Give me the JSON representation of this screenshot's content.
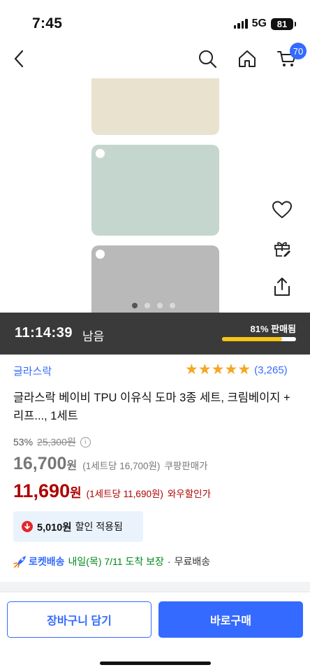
{
  "status": {
    "time": "7:45",
    "network": "5G",
    "battery": "81"
  },
  "nav": {
    "cart_count": "70",
    "icons": [
      "back-arrow-icon",
      "search-icon",
      "home-icon",
      "cart-icon"
    ]
  },
  "gallery": {
    "swatch_colors": [
      "#e8e2cf",
      "#c5d6ce",
      "#b9b9b9"
    ],
    "page_count": 4,
    "active_page": 1,
    "side_icons": [
      "heart-icon",
      "gift-icon",
      "share-icon"
    ]
  },
  "deal": {
    "time_left": "11:14:39",
    "time_suffix": "남음",
    "sold_text": "81% 판매됨",
    "sold_percent": 81
  },
  "product": {
    "brand": "글라스락",
    "rating_stars": 5,
    "review_count": "(3,265)",
    "title": "글라스락 베이비 TPU 이유식 도마 3종 세트, 크림베이지 + 리프..., 1세트"
  },
  "pricing": {
    "discount_rate": "53%",
    "original_price": "25,300원",
    "sale_price": "16,700",
    "won": "원",
    "sale_unit": "(1세트당 16,700원)",
    "sale_tag": "쿠팡판매가",
    "wow_price": "11,690",
    "wow_unit": "(1세트당 11,690원)",
    "wow_tag": "와우할인가"
  },
  "coupon": {
    "amount": "5,010원",
    "text": "할인 적용됨"
  },
  "delivery": {
    "rocket_label": "로켓배송",
    "arrival": "내일(목) 7/11 도착 보장",
    "separator": "·",
    "free": "무료배송"
  },
  "actions": {
    "cart_label": "장바구니 담기",
    "buy_label": "바로구매"
  },
  "colors": {
    "accent": "#346aff",
    "wow_red": "#ae0000",
    "timer_bg": "#3a3a3a",
    "progress": "#f7c316",
    "star": "#f5a623",
    "delivery_green": "#00891a"
  }
}
